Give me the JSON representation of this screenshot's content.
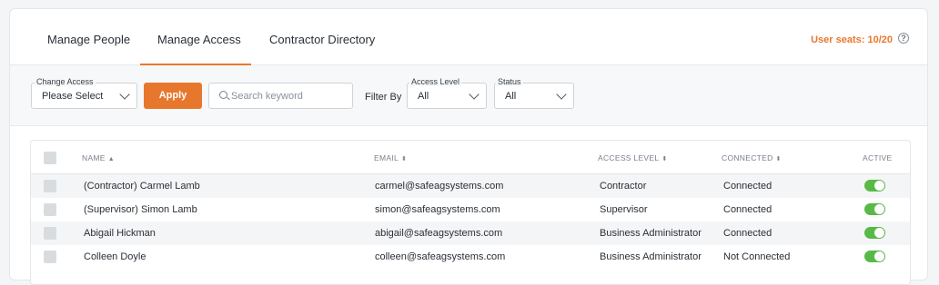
{
  "tabs": [
    {
      "label": "Manage People"
    },
    {
      "label": "Manage Access"
    },
    {
      "label": "Contractor Directory"
    }
  ],
  "active_tab": "Manage Access",
  "seats": {
    "label": "User seats: 10/20"
  },
  "help_icon": "?",
  "filters": {
    "change_access": {
      "label": "Change Access",
      "value": "Please Select"
    },
    "apply_label": "Apply",
    "search_placeholder": "Search keyword",
    "filter_by_label": "Filter By",
    "access_level": {
      "label": "Access Level",
      "value": "All"
    },
    "status": {
      "label": "Status",
      "value": "All"
    }
  },
  "table": {
    "columns": {
      "name": "NAME",
      "email": "EMAIL",
      "access_level": "ACCESS LEVEL",
      "connected": "CONNECTED",
      "active": "ACTIVE"
    },
    "rows": [
      {
        "name": "(Contractor) Carmel Lamb",
        "email": "carmel@safeagsystems.com",
        "access_level": "Contractor",
        "connected": "Connected",
        "active": true
      },
      {
        "name": "(Supervisor) Simon Lamb",
        "email": "simon@safeagsystems.com",
        "access_level": "Supervisor",
        "connected": "Connected",
        "active": true
      },
      {
        "name": "Abigail Hickman",
        "email": "abigail@safeagsystems.com",
        "access_level": "Business Administrator",
        "connected": "Connected",
        "active": true
      },
      {
        "name": "Colleen Doyle",
        "email": "colleen@safeagsystems.com",
        "access_level": "Business Administrator",
        "connected": "Not Connected",
        "active": true
      }
    ]
  },
  "colors": {
    "accent": "#e8772e",
    "toggle_on": "#58b947"
  },
  "icons": [
    "chevron-down-icon",
    "search-icon",
    "help-icon",
    "sort-icon"
  ]
}
